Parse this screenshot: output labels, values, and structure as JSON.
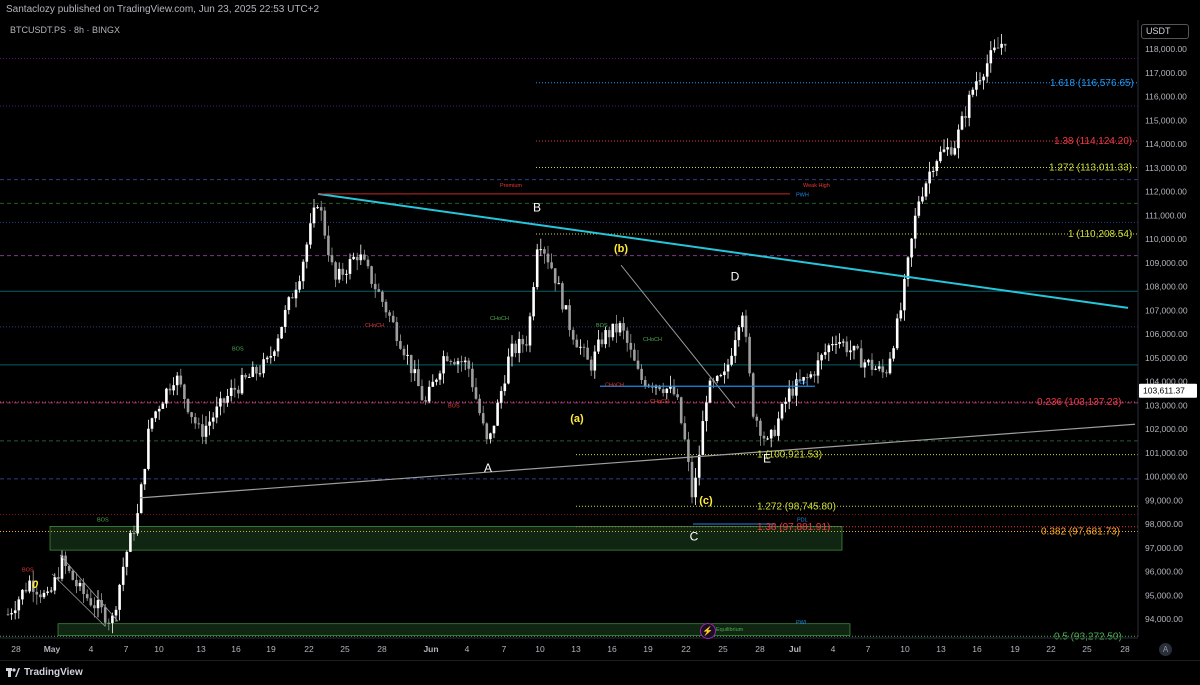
{
  "header": {
    "published": "Santaclozy published on TradingView.com, Jun 23, 2025 22:53 UTC+2",
    "symbol": "BTCUSDT.PS · 8h · BINGX",
    "currency": "USDT"
  },
  "footer": {
    "brand": "TradingView",
    "auto_label": "A"
  },
  "colors": {
    "up": "#ffffff",
    "down": "#9e9e9e",
    "trendline": "#26c6da",
    "fib_green": "#cddc39",
    "fib_red": "#f23645",
    "fib_blue": "#2196f3",
    "fib_orange": "#ffa726",
    "wave_label": "#ffffff",
    "wave_sub": "#ffeb3b"
  },
  "chart_data": {
    "type": "candlestick",
    "timeframe": "8h",
    "ylim": [
      92800,
      119200
    ],
    "y_ticks": [
      94000,
      95000,
      96000,
      97000,
      98000,
      99000,
      100000,
      101000,
      102000,
      103000,
      104000,
      105000,
      106000,
      107000,
      108000,
      109000,
      110000,
      111000,
      112000,
      113000,
      114000,
      115000,
      116000,
      117000,
      118000
    ],
    "y_tick_labels": [
      "94,000.00",
      "95,000.00",
      "96,000.00",
      "97,000.00",
      "98,000.00",
      "99,000.00",
      "100,000.00",
      "101,000.00",
      "102,000.00",
      "103,000.00",
      "104,000.00",
      "105,000.00",
      "106,000.00",
      "107,000.00",
      "108,000.00",
      "109,000.00",
      "110,000.00",
      "111,000.00",
      "112,000.00",
      "113,000.00",
      "114,000.00",
      "115,000.00",
      "116,000.00",
      "117,000.00",
      "118,000.00"
    ],
    "x_ticks": [
      "28",
      "May",
      "4",
      "7",
      "10",
      "13",
      "16",
      "19",
      "22",
      "25",
      "28",
      "Jun",
      "4",
      "7",
      "10",
      "13",
      "16",
      "19",
      "22",
      "25",
      "28",
      "Jul",
      "4",
      "7",
      "10",
      "13",
      "16",
      "19",
      "22",
      "25",
      "28"
    ],
    "last_price": "103,611.37",
    "last_price_value": 103611,
    "fib_levels": [
      {
        "label": "1.618 (116,576.65)",
        "value": 116577,
        "color": "#2196f3",
        "x0": 536
      },
      {
        "label": "1.38 (114,124.20)",
        "value": 114124,
        "color": "#f23645",
        "x0": 536
      },
      {
        "label": "1.272 (113,011.33)",
        "value": 113011,
        "color": "#cddc39",
        "x0": 536
      },
      {
        "label": "1 (110,208.54)",
        "value": 110209,
        "color": "#cddc39",
        "x0": 536
      },
      {
        "label": "0.236 (103,137.23)",
        "value": 103137,
        "color": "#f23645",
        "x0": 0
      },
      {
        "label": "1 (100,921.53)",
        "value": 100922,
        "color": "#cddc39",
        "x0": 576
      },
      {
        "label": "1.272 (98,745.80)",
        "value": 98746,
        "color": "#cddc39",
        "x0": 576
      },
      {
        "label": "1.38 (97,881.91)",
        "value": 97882,
        "color": "#f23645",
        "x0": 576
      },
      {
        "label": "0.382 (97,681.73)",
        "value": 97682,
        "color": "#ffa726",
        "x0": 0
      },
      {
        "label": "0.5 (93,272.50)",
        "value": 93273,
        "color": "#4caf50",
        "x0": 0
      }
    ],
    "wave_labels": [
      {
        "text": "A",
        "x": 488,
        "value": 100200,
        "color": "#ffffff"
      },
      {
        "text": "B",
        "x": 537,
        "value": 111150,
        "color": "#ffffff"
      },
      {
        "text": "C",
        "x": 694,
        "value": 97300,
        "color": "#ffffff"
      },
      {
        "text": "D",
        "x": 735,
        "value": 108250,
        "color": "#ffffff"
      },
      {
        "text": "E",
        "x": 767,
        "value": 100600,
        "color": "#ffffff"
      },
      {
        "text": "(a)",
        "x": 577,
        "value": 102300,
        "color": "#ffeb3b"
      },
      {
        "text": "(b)",
        "x": 621,
        "value": 109450,
        "color": "#ffeb3b"
      },
      {
        "text": "(c)",
        "x": 706,
        "value": 98850,
        "color": "#ffeb3b"
      },
      {
        "text": "0",
        "x": 35,
        "value": 95300,
        "color": "#ffeb3b"
      }
    ],
    "small_labels": [
      "Premium",
      "Weak High",
      "PWH",
      "PDH",
      "PDL",
      "Equilibrium",
      "CHoCH",
      "BOS",
      "PWL"
    ]
  }
}
